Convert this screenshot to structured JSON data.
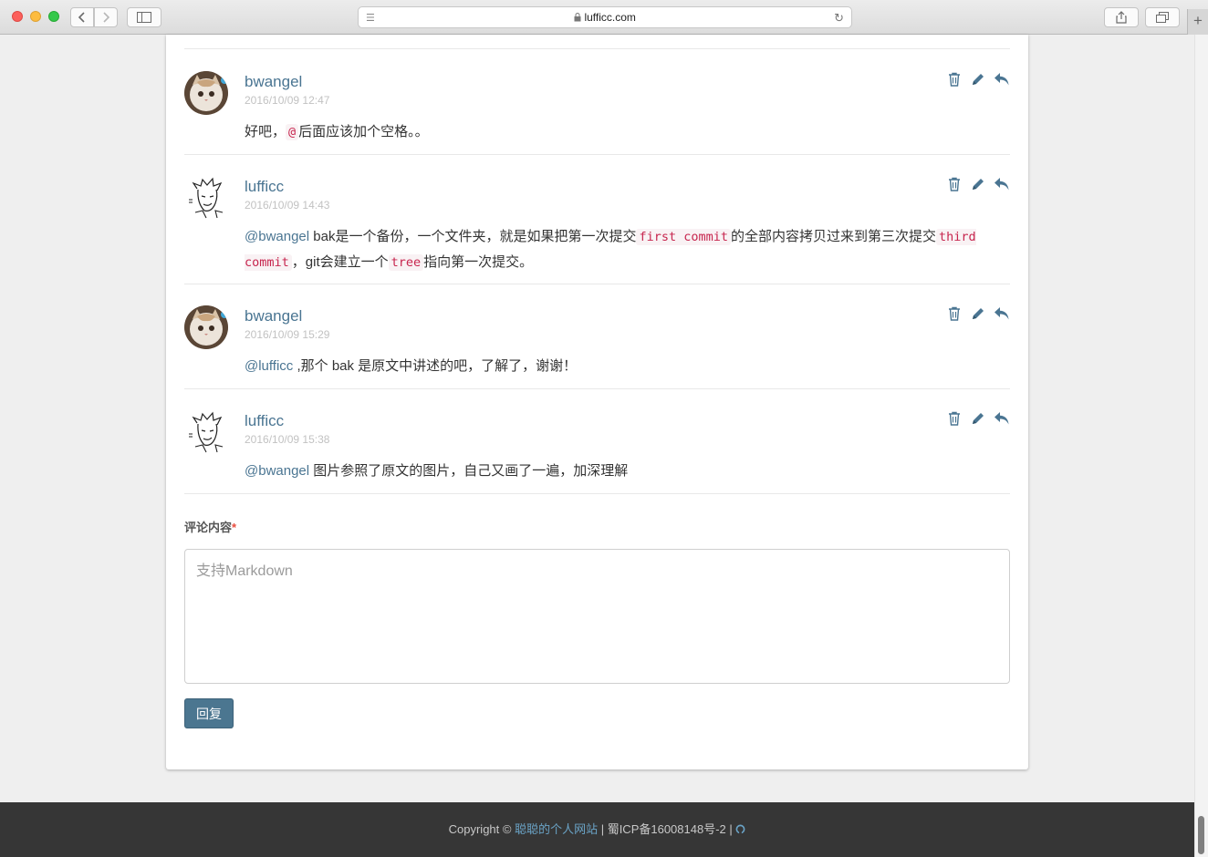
{
  "browser": {
    "url": "lufficc.com"
  },
  "icons": {
    "delete": "trash-icon",
    "edit": "pencil-icon",
    "reply": "reply-icon"
  },
  "comments": [
    {
      "author": "bwangel",
      "avatar": "cat",
      "time": "2016/10/09 12:47",
      "segments": [
        {
          "t": "text",
          "v": "好吧，"
        },
        {
          "t": "code",
          "v": "@"
        },
        {
          "t": "text",
          "v": "后面应该加个空格。。"
        }
      ]
    },
    {
      "author": "lufficc",
      "avatar": "sketch",
      "time": "2016/10/09 14:43",
      "segments": [
        {
          "t": "mention",
          "v": "@bwangel"
        },
        {
          "t": "text",
          "v": " bak是一个备份，一个文件夹，就是如果把第一次提交"
        },
        {
          "t": "code",
          "v": "first commit"
        },
        {
          "t": "text",
          "v": "的全部内容拷贝过来到第三次提交"
        },
        {
          "t": "code",
          "v": "third commit"
        },
        {
          "t": "text",
          "v": "，git会建立一个"
        },
        {
          "t": "code",
          "v": "tree"
        },
        {
          "t": "text",
          "v": "指向第一次提交。"
        }
      ]
    },
    {
      "author": "bwangel",
      "avatar": "cat",
      "time": "2016/10/09 15:29",
      "segments": [
        {
          "t": "mention",
          "v": "@lufficc"
        },
        {
          "t": "text",
          "v": " ,那个 bak 是原文中讲述的吧，了解了，谢谢！"
        }
      ]
    },
    {
      "author": "lufficc",
      "avatar": "sketch",
      "time": "2016/10/09 15:38",
      "segments": [
        {
          "t": "mention",
          "v": "@bwangel"
        },
        {
          "t": "text",
          "v": " 图片参照了原文的图片，自己又画了一遍，加深理解"
        }
      ]
    }
  ],
  "form": {
    "label": "评论内容",
    "required_mark": "*",
    "placeholder": "支持Markdown",
    "submit_label": "回复"
  },
  "footer": {
    "prefix": "Copyright © ",
    "site_link": "聪聪的个人网站",
    "icp": " | 蜀ICP备16008148号-2 | "
  },
  "colors": {
    "accent": "#4a7592",
    "code_text": "#c7254e",
    "code_bg": "#f9f2f4",
    "button": "#4b7690",
    "footer_bg": "#363636"
  }
}
